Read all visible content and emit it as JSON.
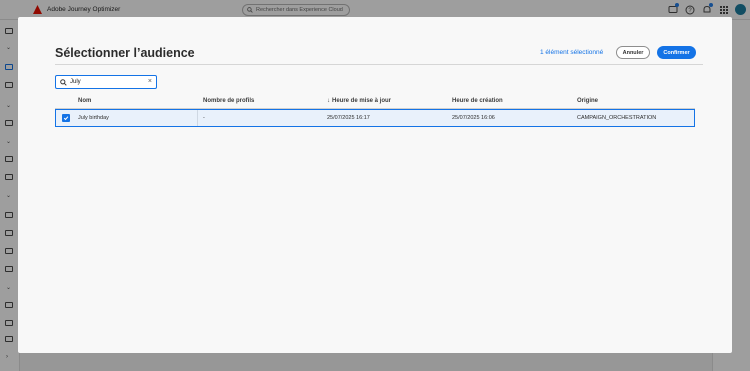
{
  "shell": {
    "app_title": "Adobe Journey Optimizer",
    "search_placeholder": "Rechercher dans Experience Cloud"
  },
  "dialog": {
    "title": "Sélectionner l’audience",
    "selected_count": "1 élément sélectionné",
    "cancel_label": "Annuler",
    "confirm_label": "Confirmer",
    "search_value": "July"
  },
  "table": {
    "headers": [
      "Nom",
      "Nombre de profils",
      "Heure de mise à jour",
      "Heure de création",
      "Origine"
    ],
    "sort_indicator": "↓",
    "rows": [
      {
        "name": "July birthday",
        "profiles": "-",
        "updated": "25/07/2025 16:17",
        "created": "25/07/2025 16:06",
        "origin": "CAMPAIGN_ORCHESTRATION",
        "selected": true
      }
    ]
  },
  "colors": {
    "accent": "#1473e6",
    "row_selected_bg": "#e9f1fb",
    "brand_red": "#eb1000"
  }
}
